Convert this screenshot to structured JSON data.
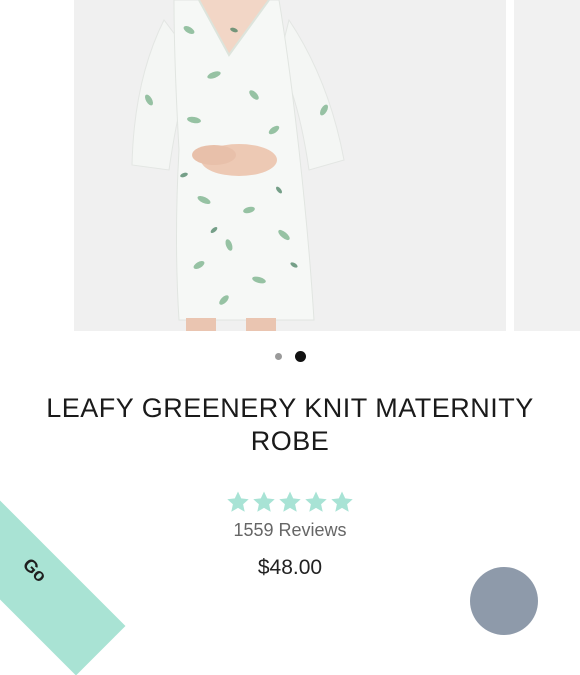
{
  "product": {
    "title": "LEAFY GREENERY KNIT MATERNITY ROBE",
    "reviews_label": "1559 Reviews",
    "rating": 5,
    "rating_max": 5,
    "price": "$48.00"
  },
  "gallery": {
    "slide_count": 2,
    "active_index": 1,
    "zoom_icon": "search-icon"
  },
  "corner_badge": {
    "text": "Go"
  },
  "colors": {
    "star": "#a8e3d5",
    "badge": "#a9e3d4",
    "chat": "#8e9aaa"
  }
}
